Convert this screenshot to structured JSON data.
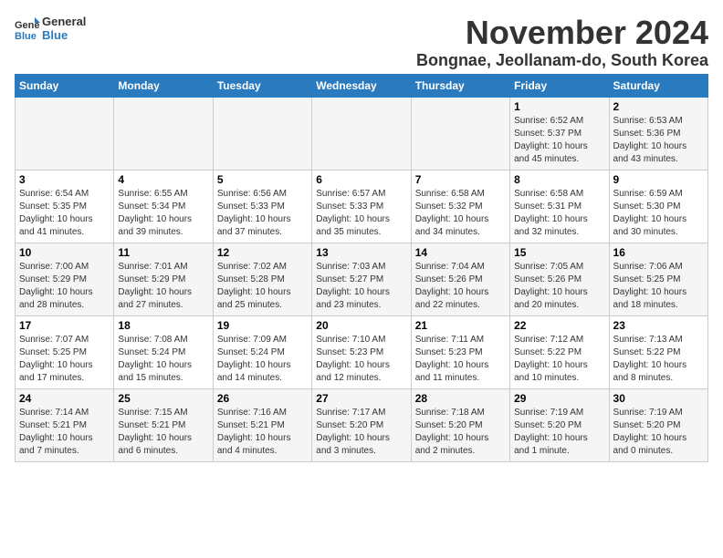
{
  "header": {
    "logo_general": "General",
    "logo_blue": "Blue",
    "title": "November 2024",
    "subtitle": "Bongnae, Jeollanam-do, South Korea"
  },
  "weekdays": [
    "Sunday",
    "Monday",
    "Tuesday",
    "Wednesday",
    "Thursday",
    "Friday",
    "Saturday"
  ],
  "weeks": [
    [
      {
        "day": "",
        "info": ""
      },
      {
        "day": "",
        "info": ""
      },
      {
        "day": "",
        "info": ""
      },
      {
        "day": "",
        "info": ""
      },
      {
        "day": "",
        "info": ""
      },
      {
        "day": "1",
        "info": "Sunrise: 6:52 AM\nSunset: 5:37 PM\nDaylight: 10 hours\nand 45 minutes."
      },
      {
        "day": "2",
        "info": "Sunrise: 6:53 AM\nSunset: 5:36 PM\nDaylight: 10 hours\nand 43 minutes."
      }
    ],
    [
      {
        "day": "3",
        "info": "Sunrise: 6:54 AM\nSunset: 5:35 PM\nDaylight: 10 hours\nand 41 minutes."
      },
      {
        "day": "4",
        "info": "Sunrise: 6:55 AM\nSunset: 5:34 PM\nDaylight: 10 hours\nand 39 minutes."
      },
      {
        "day": "5",
        "info": "Sunrise: 6:56 AM\nSunset: 5:33 PM\nDaylight: 10 hours\nand 37 minutes."
      },
      {
        "day": "6",
        "info": "Sunrise: 6:57 AM\nSunset: 5:33 PM\nDaylight: 10 hours\nand 35 minutes."
      },
      {
        "day": "7",
        "info": "Sunrise: 6:58 AM\nSunset: 5:32 PM\nDaylight: 10 hours\nand 34 minutes."
      },
      {
        "day": "8",
        "info": "Sunrise: 6:58 AM\nSunset: 5:31 PM\nDaylight: 10 hours\nand 32 minutes."
      },
      {
        "day": "9",
        "info": "Sunrise: 6:59 AM\nSunset: 5:30 PM\nDaylight: 10 hours\nand 30 minutes."
      }
    ],
    [
      {
        "day": "10",
        "info": "Sunrise: 7:00 AM\nSunset: 5:29 PM\nDaylight: 10 hours\nand 28 minutes."
      },
      {
        "day": "11",
        "info": "Sunrise: 7:01 AM\nSunset: 5:29 PM\nDaylight: 10 hours\nand 27 minutes."
      },
      {
        "day": "12",
        "info": "Sunrise: 7:02 AM\nSunset: 5:28 PM\nDaylight: 10 hours\nand 25 minutes."
      },
      {
        "day": "13",
        "info": "Sunrise: 7:03 AM\nSunset: 5:27 PM\nDaylight: 10 hours\nand 23 minutes."
      },
      {
        "day": "14",
        "info": "Sunrise: 7:04 AM\nSunset: 5:26 PM\nDaylight: 10 hours\nand 22 minutes."
      },
      {
        "day": "15",
        "info": "Sunrise: 7:05 AM\nSunset: 5:26 PM\nDaylight: 10 hours\nand 20 minutes."
      },
      {
        "day": "16",
        "info": "Sunrise: 7:06 AM\nSunset: 5:25 PM\nDaylight: 10 hours\nand 18 minutes."
      }
    ],
    [
      {
        "day": "17",
        "info": "Sunrise: 7:07 AM\nSunset: 5:25 PM\nDaylight: 10 hours\nand 17 minutes."
      },
      {
        "day": "18",
        "info": "Sunrise: 7:08 AM\nSunset: 5:24 PM\nDaylight: 10 hours\nand 15 minutes."
      },
      {
        "day": "19",
        "info": "Sunrise: 7:09 AM\nSunset: 5:24 PM\nDaylight: 10 hours\nand 14 minutes."
      },
      {
        "day": "20",
        "info": "Sunrise: 7:10 AM\nSunset: 5:23 PM\nDaylight: 10 hours\nand 12 minutes."
      },
      {
        "day": "21",
        "info": "Sunrise: 7:11 AM\nSunset: 5:23 PM\nDaylight: 10 hours\nand 11 minutes."
      },
      {
        "day": "22",
        "info": "Sunrise: 7:12 AM\nSunset: 5:22 PM\nDaylight: 10 hours\nand 10 minutes."
      },
      {
        "day": "23",
        "info": "Sunrise: 7:13 AM\nSunset: 5:22 PM\nDaylight: 10 hours\nand 8 minutes."
      }
    ],
    [
      {
        "day": "24",
        "info": "Sunrise: 7:14 AM\nSunset: 5:21 PM\nDaylight: 10 hours\nand 7 minutes."
      },
      {
        "day": "25",
        "info": "Sunrise: 7:15 AM\nSunset: 5:21 PM\nDaylight: 10 hours\nand 6 minutes."
      },
      {
        "day": "26",
        "info": "Sunrise: 7:16 AM\nSunset: 5:21 PM\nDaylight: 10 hours\nand 4 minutes."
      },
      {
        "day": "27",
        "info": "Sunrise: 7:17 AM\nSunset: 5:20 PM\nDaylight: 10 hours\nand 3 minutes."
      },
      {
        "day": "28",
        "info": "Sunrise: 7:18 AM\nSunset: 5:20 PM\nDaylight: 10 hours\nand 2 minutes."
      },
      {
        "day": "29",
        "info": "Sunrise: 7:19 AM\nSunset: 5:20 PM\nDaylight: 10 hours\nand 1 minute."
      },
      {
        "day": "30",
        "info": "Sunrise: 7:19 AM\nSunset: 5:20 PM\nDaylight: 10 hours\nand 0 minutes."
      }
    ]
  ]
}
